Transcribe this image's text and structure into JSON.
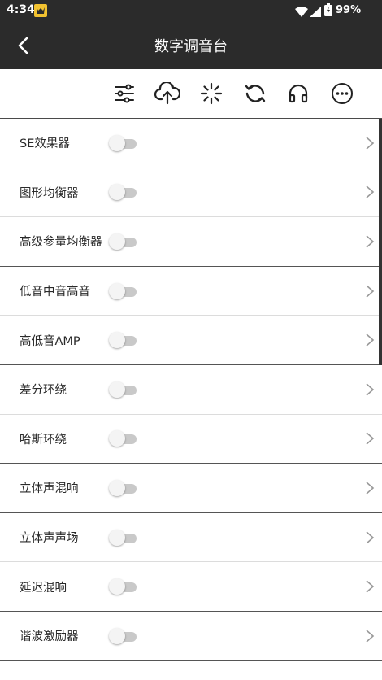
{
  "status_bar": {
    "time": "4:34",
    "battery_percent": "99%"
  },
  "app_bar": {
    "title": "数字调音台",
    "back_icon": "chevron-left-icon"
  },
  "toolbar": {
    "buttons": [
      {
        "icon": "sliders-icon"
      },
      {
        "icon": "cloud-upload-icon"
      },
      {
        "icon": "loading-spinner-icon"
      },
      {
        "icon": "refresh-icon"
      },
      {
        "icon": "headphones-icon"
      },
      {
        "icon": "more-options-icon"
      }
    ]
  },
  "list": {
    "items": [
      {
        "label": "SE效果器",
        "enabled": false
      },
      {
        "label": "图形均衡器",
        "enabled": false
      },
      {
        "label": "高级参量均衡器",
        "enabled": false
      },
      {
        "label": "低音中音高音",
        "enabled": false
      },
      {
        "label": "高低音AMP",
        "enabled": false
      },
      {
        "label": "差分环绕",
        "enabled": false
      },
      {
        "label": "哈斯环绕",
        "enabled": false
      },
      {
        "label": "立体声混响",
        "enabled": false
      },
      {
        "label": "立体声声场",
        "enabled": false
      },
      {
        "label": "延迟混响",
        "enabled": false
      },
      {
        "label": "谐波激励器",
        "enabled": false
      }
    ]
  },
  "colors": {
    "header_bg": "#2b2b2b",
    "toggle_track_off": "#c9c9c9",
    "toggle_knob_off": "#f4f4f4"
  }
}
